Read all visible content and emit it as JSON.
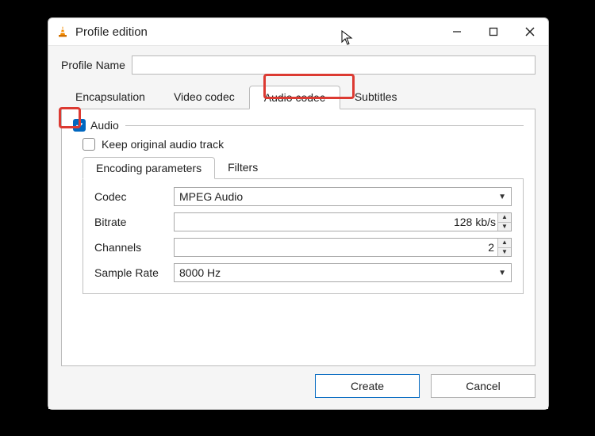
{
  "window": {
    "title": "Profile edition"
  },
  "profile": {
    "label": "Profile Name",
    "value": ""
  },
  "tabs": {
    "encapsulation": "Encapsulation",
    "video_codec": "Video codec",
    "audio_codec": "Audio codec",
    "subtitles": "Subtitles"
  },
  "audio": {
    "group_label": "Audio",
    "enabled": true,
    "keep_original_label": "Keep original audio track",
    "keep_original_checked": false,
    "subtabs": {
      "encoding": "Encoding parameters",
      "filters": "Filters"
    },
    "params": {
      "codec_label": "Codec",
      "codec_value": "MPEG Audio",
      "bitrate_label": "Bitrate",
      "bitrate_value": "128",
      "bitrate_unit": "kb/s",
      "channels_label": "Channels",
      "channels_value": "2",
      "samplerate_label": "Sample Rate",
      "samplerate_value": "8000 Hz"
    }
  },
  "buttons": {
    "create": "Create",
    "cancel": "Cancel"
  }
}
